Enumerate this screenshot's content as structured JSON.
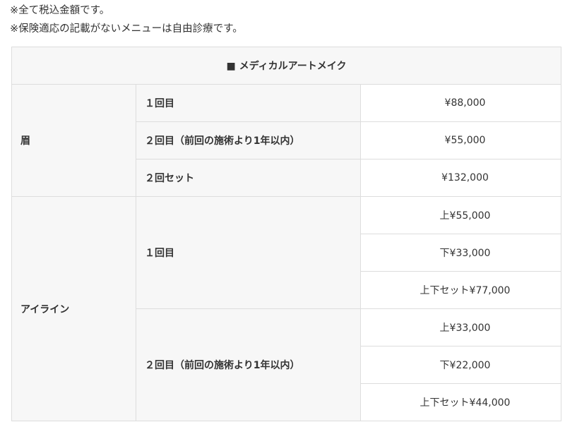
{
  "notes": [
    "※全て税込金額です。",
    "※保険適応の記載がないメニューは自由診療です。"
  ],
  "table": {
    "header": "■ メディカルアートメイク",
    "eyebrow": {
      "category": "眉",
      "rows": [
        {
          "label": "１回目",
          "price": "¥88,000"
        },
        {
          "label": "２回目（前回の施術より1年以内）",
          "price": "¥55,000"
        },
        {
          "label": "２回セット",
          "price": "¥132,000"
        }
      ]
    },
    "eyeline": {
      "category": "アイライン",
      "groups": [
        {
          "label": "１回目",
          "prices": [
            "上¥55,000",
            "下¥33,000",
            "上下セット¥77,000"
          ]
        },
        {
          "label": "２回目（前回の施術より1年以内）",
          "prices": [
            "上¥33,000",
            "下¥22,000",
            "上下セット¥44,000"
          ]
        }
      ]
    }
  }
}
